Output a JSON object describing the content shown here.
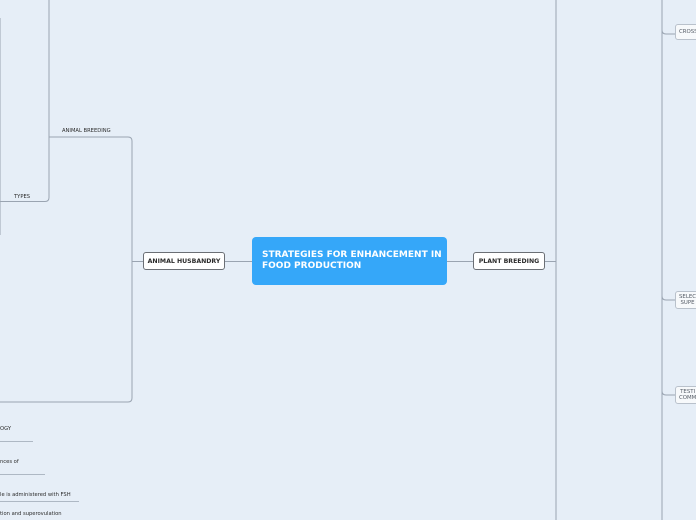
{
  "central": {
    "title": "STRATEGIES FOR ENHANCEMENT IN\nFOOD PRODUCTION"
  },
  "nodes": {
    "animal_husbandry": "ANIMAL HUSBANDRY",
    "plant_breeding": "PLANT BREEDING",
    "animal_breeding": "ANIMAL BREEDING",
    "types": "TYPES",
    "cross": "CROSS",
    "selec_supe": "SELEC\nSUPE",
    "testi_comm": "TESTI\nCOMM"
  },
  "fragments": {
    "ogy": "OGY",
    "nces_of": "nces of",
    "fsh": "le is administered with FSH",
    "superovulation": "tion and superovulation"
  },
  "colors": {
    "background": "#e6eef7",
    "central": "#35a7f9",
    "line": "#9aa4b1"
  }
}
